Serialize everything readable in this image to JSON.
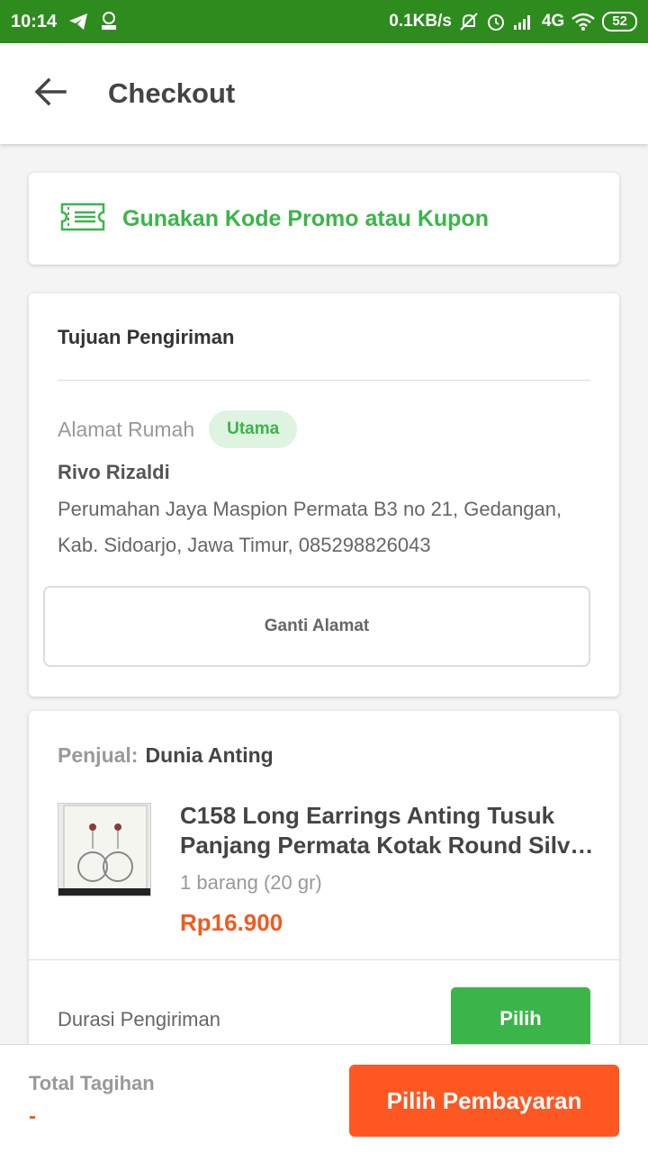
{
  "status_bar": {
    "time": "10:14",
    "network_speed": "0.1KB/s",
    "network_type": "4G",
    "battery": "52"
  },
  "header": {
    "title": "Checkout"
  },
  "promo": {
    "label": "Gunakan Kode Promo atau Kupon"
  },
  "shipping": {
    "section_title": "Tujuan Pengiriman",
    "address_label": "Alamat Rumah",
    "badge": "Utama",
    "recipient": "Rivo Rizaldi",
    "address": "Perumahan Jaya Maspion Permata B3 no 21, Gedangan, Kab. Sidoarjo, Jawa Timur, 085298826043",
    "change_button": "Ganti Alamat"
  },
  "order": {
    "seller_label": "Penjual:",
    "seller_name": "Dunia Anting",
    "product_name": "C158 Long Earrings Anting Tusuk Panjang Permata Kotak Round Silv…",
    "quantity": "1 barang (20 gr)",
    "price": "Rp16.900",
    "duration_label": "Durasi Pengiriman",
    "choose_button": "Pilih"
  },
  "footer": {
    "total_label": "Total Tagihan",
    "total_value": "-",
    "pay_button": "Pilih Pembayaran"
  },
  "colors": {
    "status_bar": "#2e8b1e",
    "accent_green": "#3bb54a",
    "accent_orange": "#ff5722",
    "price": "#f05a22"
  },
  "icons": {
    "back": "arrow-left-icon",
    "promo": "ticket-icon"
  }
}
